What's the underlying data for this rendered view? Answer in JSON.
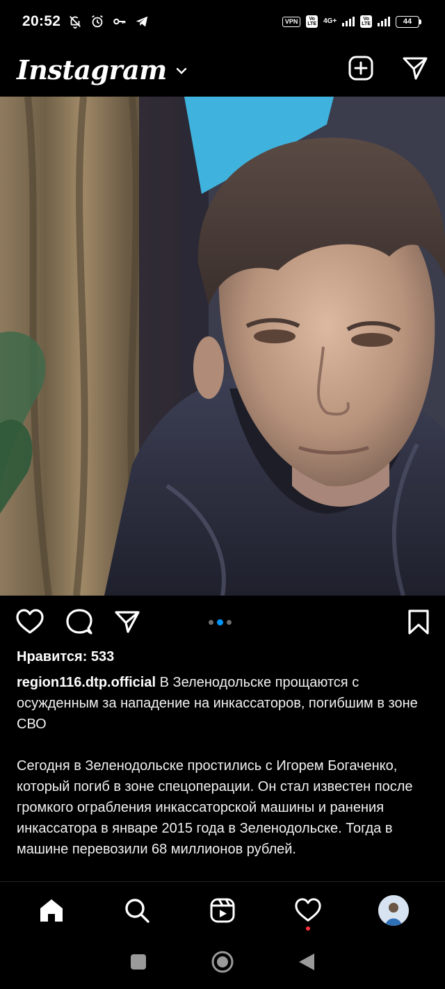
{
  "status": {
    "time": "20:52",
    "vpn": "VPN",
    "volte_top": "Vo",
    "volte_bottom": "LTE",
    "network": "4G+",
    "battery": "44"
  },
  "header": {
    "logo": "Instagram",
    "icons": [
      "chevron-down-icon",
      "new-post-icon",
      "direct-messages-icon"
    ]
  },
  "post": {
    "likes": "Нравится: 533",
    "username": "region116.dtp.official",
    "headline": " В Зеленодольске прощаются с осужденным за нападение на инкассаторов, погибшим в зоне СВО",
    "body": "Сегодня в Зеленодольске простились с Игорем Богаченко, который погиб в зоне спецоперации. Он стал известен после громкого ограбления инкассаторской машины и ранения инкассатора в январе 2015 года в Зеленодольске. Тогда в машине перевозили 68 миллионов рублей.",
    "carousel_dots": 3,
    "carousel_active": 2
  },
  "colors": {
    "accent": "#0095f6",
    "notification": "#ff3040",
    "background": "#000000"
  },
  "tabbar": {
    "icons": [
      "home-icon",
      "search-icon",
      "reels-icon",
      "activity-heart-icon",
      "profile-avatar"
    ]
  },
  "navbar": {
    "icons": [
      "recents-square-icon",
      "home-circle-icon",
      "back-triangle-icon"
    ]
  }
}
